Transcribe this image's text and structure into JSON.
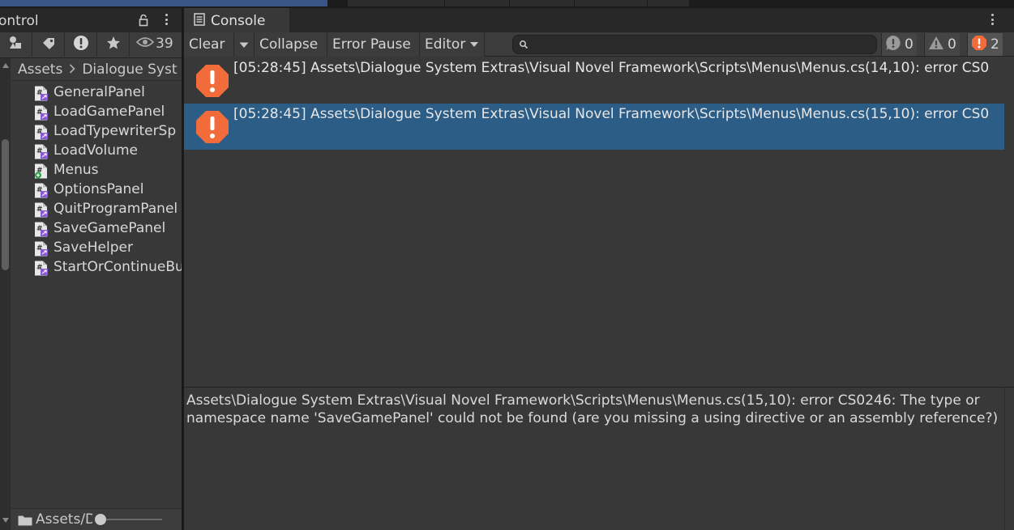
{
  "left_panel": {
    "tab_title": "ontrol",
    "filter_count": "39",
    "breadcrumb": [
      "Assets",
      "Dialogue Syst"
    ],
    "files": [
      {
        "name": "GeneralPanel",
        "icon": "csharp-script-icon"
      },
      {
        "name": "LoadGamePanel",
        "icon": "csharp-script-icon"
      },
      {
        "name": "LoadTypewriterSp",
        "icon": "csharp-script-icon"
      },
      {
        "name": "LoadVolume",
        "icon": "csharp-script-icon"
      },
      {
        "name": "Menus",
        "icon": "csharp-script-new-icon"
      },
      {
        "name": "OptionsPanel",
        "icon": "csharp-script-icon"
      },
      {
        "name": "QuitProgramPanel",
        "icon": "csharp-script-icon"
      },
      {
        "name": "SaveGamePanel",
        "icon": "csharp-script-icon"
      },
      {
        "name": "SaveHelper",
        "icon": "csharp-script-icon"
      },
      {
        "name": "StartOrContinueBu",
        "icon": "csharp-script-icon"
      }
    ],
    "footer_path": "Assets/D"
  },
  "console": {
    "tab_title": "Console",
    "toolbar": {
      "clear_label": "Clear",
      "collapse_label": "Collapse",
      "error_pause_label": "Error Pause",
      "editor_label": "Editor"
    },
    "search": {
      "placeholder": ""
    },
    "counts": {
      "info": "0",
      "warning": "0",
      "error": "2"
    },
    "log_entries": [
      {
        "text": "[05:28:45] Assets\\Dialogue System Extras\\Visual Novel Framework\\Scripts\\Menus\\Menus.cs(14,10): error CS0",
        "selected": false
      },
      {
        "text": "[05:28:45] Assets\\Dialogue System Extras\\Visual Novel Framework\\Scripts\\Menus\\Menus.cs(15,10): error CS0",
        "selected": true
      }
    ],
    "detail_text": "Assets\\Dialogue System Extras\\Visual Novel Framework\\Scripts\\Menus\\Menus.cs(15,10): error CS0246: The type or namespace name 'SaveGamePanel' could not be found (are you missing a using directive or an assembly reference?)"
  },
  "colors": {
    "error_orange": "#f26b3a",
    "selection_blue": "#2c5d87",
    "panel_bg": "#383838"
  }
}
